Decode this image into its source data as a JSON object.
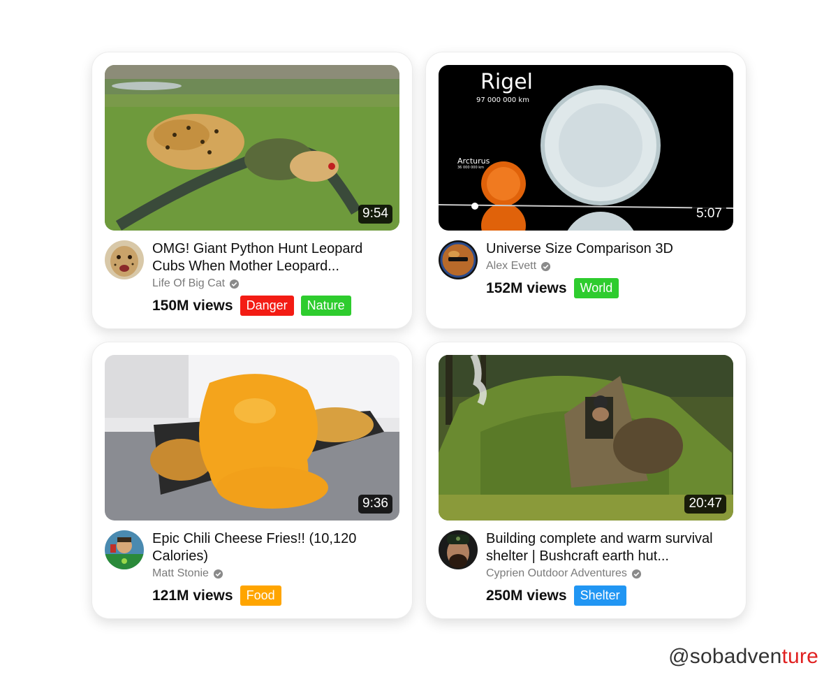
{
  "videos": [
    {
      "title": "OMG! Giant Python Hunt Leopard Cubs When Mother Leopard...",
      "channel": "Life Of Big Cat",
      "views": "150M views",
      "duration": "9:54",
      "tags": [
        {
          "label": "Danger",
          "color": "#f31c14"
        },
        {
          "label": "Nature",
          "color": "#2ecc2e"
        }
      ]
    },
    {
      "title": "Universe Size Comparison 3D",
      "channel": "Alex Evett",
      "views": "152M views",
      "duration": "5:07",
      "thumbnail_text": {
        "star_main": "Rigel",
        "star_main_size": "97 000 000 km",
        "star_small": "Arcturus",
        "star_small_size": "36 000 000 km"
      },
      "tags": [
        {
          "label": "World",
          "color": "#2ecc2e"
        }
      ]
    },
    {
      "title": "Epic Chili Cheese Fries!! (10,120 Calories)",
      "channel": "Matt Stonie",
      "views": "121M views",
      "duration": "9:36",
      "tags": [
        {
          "label": "Food",
          "color": "#ffa500"
        }
      ]
    },
    {
      "title": "Building complete and warm survival shelter | Bushcraft earth hut...",
      "channel": "Cyprien Outdoor Adventures",
      "views": "250M views",
      "duration": "20:47",
      "tags": [
        {
          "label": "Shelter",
          "color": "#2196f3"
        }
      ]
    }
  ],
  "watermark": {
    "prefix": "@sobadven",
    "highlight": "ture"
  },
  "icons": {
    "verified": "verified-check-icon"
  }
}
